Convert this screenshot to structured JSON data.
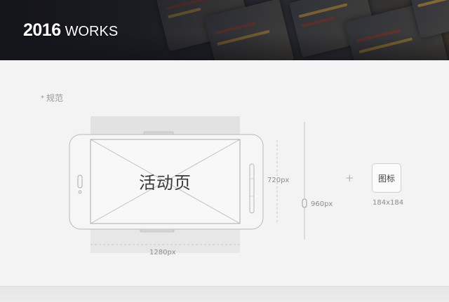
{
  "banner": {
    "year": "2016",
    "title": "WORKS"
  },
  "spec": {
    "note_marker": "*",
    "note_text": "规范",
    "page_label": "活动页",
    "width_label": "1280px",
    "height_label": "720px",
    "screen_height_label": "960px",
    "icon_label": "图标",
    "icon_size_label": "184x184"
  }
}
